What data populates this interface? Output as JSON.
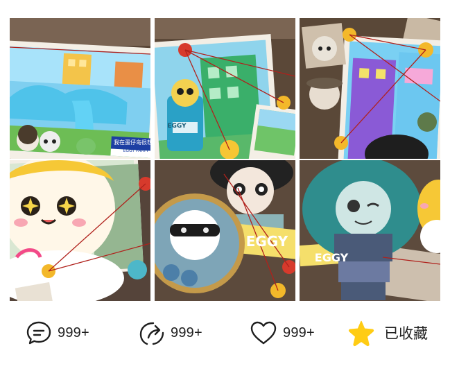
{
  "gallery": {
    "tiles": [
      {
        "id": "tile-1",
        "sign_text": "我在蛋仔岛很想你",
        "sign_subtext": "EGGY PARTY"
      },
      {
        "id": "tile-2",
        "label": "EGGY"
      },
      {
        "id": "tile-3"
      },
      {
        "id": "tile-4"
      },
      {
        "id": "tile-5",
        "banner_text": "EGGY"
      },
      {
        "id": "tile-6",
        "banner_text": "EGGY"
      }
    ]
  },
  "actions": {
    "comment": {
      "icon": "comment-icon",
      "count": "999+"
    },
    "share": {
      "icon": "share-icon",
      "count": "999+"
    },
    "like": {
      "icon": "heart-icon",
      "count": "999+"
    },
    "favorite": {
      "icon": "star-icon",
      "label": "已收藏",
      "color": "#ffcc14"
    }
  }
}
